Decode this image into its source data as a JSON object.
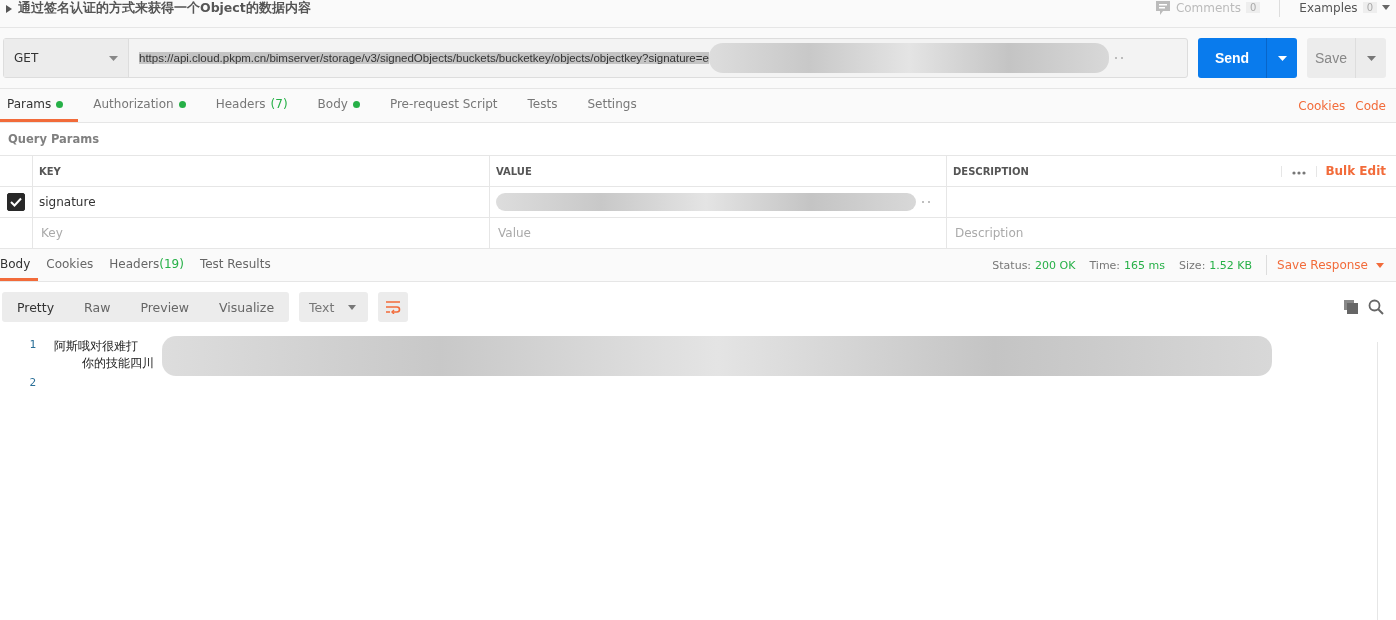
{
  "request": {
    "title": "通过签名认证的方式来获得一个Object的数据内容",
    "comments": {
      "label": "Comments",
      "count": "0"
    },
    "examples": {
      "label": "Examples",
      "count": "0"
    }
  },
  "url_bar": {
    "method": "GET",
    "url": "https://api.cloud.pkpm.cn/bimserver/storage/v3/signedObjects/buckets/bucketkey/objects/objectkey?signature=e",
    "url_redacted": true,
    "send": "Send",
    "save": "Save"
  },
  "request_tabs": [
    {
      "label": "Params",
      "dot": true,
      "selected": true
    },
    {
      "label": "Authorization",
      "dot": true,
      "selected": false
    },
    {
      "label": "Headers",
      "count": "(7)",
      "dot": false,
      "selected": false
    },
    {
      "label": "Body",
      "dot": true,
      "selected": false
    },
    {
      "label": "Pre-request Script",
      "dot": false,
      "selected": false
    },
    {
      "label": "Tests",
      "dot": false,
      "selected": false
    },
    {
      "label": "Settings",
      "dot": false,
      "selected": false
    }
  ],
  "request_links": [
    "Cookies",
    "Code"
  ],
  "query_params": {
    "title": "Query Params",
    "columns": [
      "KEY",
      "VALUE",
      "DESCRIPTION"
    ],
    "bulk_edit": "Bulk Edit",
    "rows": [
      {
        "checked": true,
        "key": "signature",
        "value_redacted": true
      }
    ],
    "new_row": {
      "key_placeholder": "Key",
      "value_placeholder": "Value",
      "description_placeholder": "Description"
    }
  },
  "response_tabs": [
    {
      "label": "Body",
      "selected": true
    },
    {
      "label": "Cookies",
      "selected": false
    },
    {
      "label": "Headers",
      "count": "(19)",
      "selected": false
    },
    {
      "label": "Test Results",
      "selected": false
    }
  ],
  "response_meta": [
    {
      "label": "Status:",
      "value": "200 OK"
    },
    {
      "label": "Time:",
      "value": "165 ms"
    },
    {
      "label": "Size:",
      "value": "1.52 KB"
    }
  ],
  "save_response": "Save Response",
  "view_modes": [
    {
      "label": "Pretty",
      "selected": true
    },
    {
      "label": "Raw",
      "selected": false
    },
    {
      "label": "Preview",
      "selected": false
    },
    {
      "label": "Visualize",
      "selected": false
    }
  ],
  "format": "Text",
  "wrap": true,
  "code_lines": [
    {
      "number": "1",
      "texts": [
        "阿斯哦对很难打",
        "你的技能四川"
      ],
      "redacted": true
    },
    {
      "number": "2",
      "redacted": false
    }
  ]
}
